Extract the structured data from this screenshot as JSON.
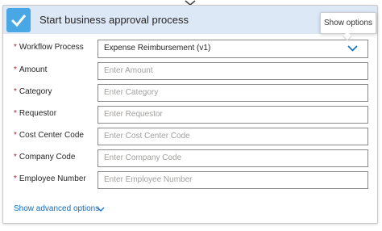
{
  "header": {
    "title": "Start business approval process",
    "tooltip": "Show options"
  },
  "fields": [
    {
      "label": "Workflow Process",
      "value": "Expense Reimbursement (v1)",
      "type": "select"
    },
    {
      "label": "Amount",
      "placeholder": "Enter Amount"
    },
    {
      "label": "Category",
      "placeholder": "Enter Category"
    },
    {
      "label": "Requestor",
      "placeholder": "Enter Requestor"
    },
    {
      "label": "Cost Center Code",
      "placeholder": "Enter Cost Center Code"
    },
    {
      "label": "Company Code",
      "placeholder": "Enter Company Code"
    },
    {
      "label": "Employee Number",
      "placeholder": "Enter Employee Number"
    }
  ],
  "required_marker": "*",
  "advanced": {
    "label": "Show advanced options"
  },
  "colors": {
    "accent": "#106ebe",
    "required": "#a4262c",
    "header_bg": "#dde8f6",
    "logo": "#4aa7e6"
  },
  "icons": {
    "logo": "approval-check-icon",
    "dropdown": "chevron-down-icon",
    "connector": "connector-arrow-icon"
  }
}
